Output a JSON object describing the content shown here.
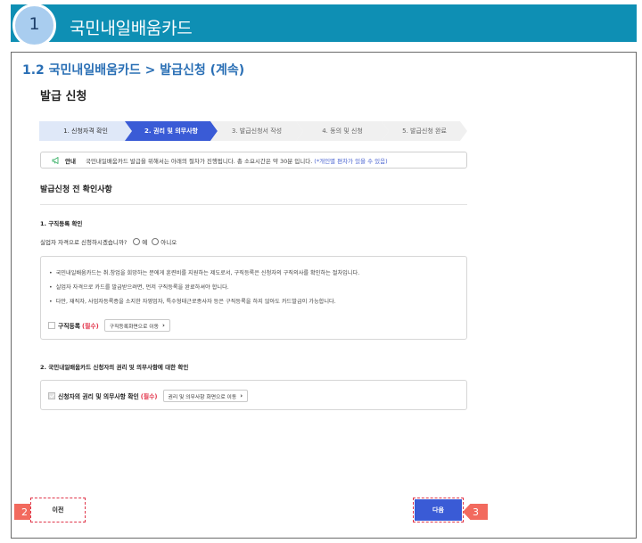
{
  "banner": {
    "step_number": "1",
    "title": "국민내일배움카드"
  },
  "section": {
    "heading": "1.2 국민내일배움카드 > 발급신청 (계속)",
    "page_title": "발급 신청"
  },
  "stepper": {
    "steps": [
      {
        "label": "1. 신청자격 확인",
        "state": "done"
      },
      {
        "label": "2. 권리 및 의무사항",
        "state": "active"
      },
      {
        "label": "3. 발급신청서 작성",
        "state": "pending"
      },
      {
        "label": "4. 동의 및 신청",
        "state": "pending"
      },
      {
        "label": "5. 발급신청 완료",
        "state": "pending"
      }
    ]
  },
  "notice": {
    "label": "안내",
    "text": "국민내일배움카드 발급을 위해서는 아래의 절차가 진행됩니다. 총 소요시간은 약 30분 입니다.",
    "note": "(*개인별 편차가 있을 수 있음)"
  },
  "confirm": {
    "title": "발급신청 전 확인사항"
  },
  "job_registration": {
    "heading": "1. 구직등록 확인",
    "question": "실업자 자격으로 신청하시겠습니까?",
    "options": [
      "예",
      "아니오"
    ],
    "bullets": [
      "국민내일배움카드는 취.창업을 희망하는 분에게 훈련비를 지원하는 제도로서, 구직등록은 신청자의 구직의사를 확인하는 절차입니다.",
      "실업자 자격으로 카드를 발급받으려면, 먼저 구직등록을 완료하셔야 합니다.",
      "다만, 재직자, 사업자등록증을 소지한 자영업자, 특수형태근로종사자 등은 구직등록을 하지 않아도 카드발급이 가능합니다."
    ],
    "check_label": "구직등록",
    "required": "(필수)",
    "link_label": "구직등록화면으로 이동"
  },
  "rights": {
    "heading": "2. 국민내일배움카드 신청자의 권리 및 의무사항에 대한 확인",
    "check_label": "신청자의 권리 및 의무사항 확인",
    "required": "(필수)",
    "link_label": "권리 및 의무사항 화면으로 이동"
  },
  "footer": {
    "prev_label": "이전",
    "next_label": "다음",
    "marker_prev": "2",
    "marker_next": "3"
  },
  "colors": {
    "banner": "#0e8fb4",
    "heading_blue": "#2a6fb5",
    "primary": "#3a5bd6",
    "required_red": "#e2344a",
    "marker": "#f26a5e"
  }
}
